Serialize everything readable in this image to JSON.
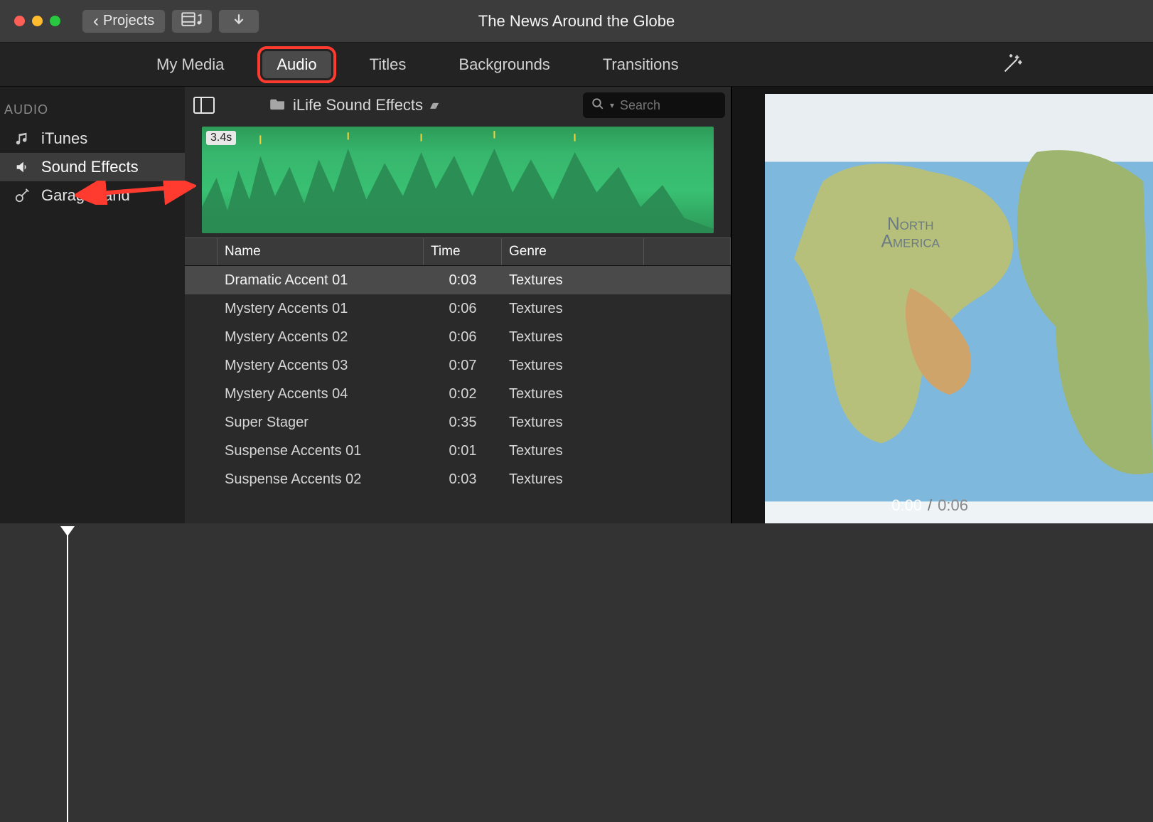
{
  "window": {
    "title": "The News Around the Globe"
  },
  "toolbar": {
    "projects_label": "Projects"
  },
  "tabs": {
    "items": [
      {
        "label": "My Media"
      },
      {
        "label": "Audio"
      },
      {
        "label": "Titles"
      },
      {
        "label": "Backgrounds"
      },
      {
        "label": "Transitions"
      }
    ],
    "active_index": 1
  },
  "sidebar": {
    "heading": "AUDIO",
    "items": [
      {
        "label": "iTunes",
        "icon": "music-note"
      },
      {
        "label": "Sound Effects",
        "icon": "speaker"
      },
      {
        "label": "GarageBand",
        "icon": "guitar"
      }
    ],
    "selected_index": 1
  },
  "browser": {
    "album_label": "iLife Sound Effects",
    "search_placeholder": "Search",
    "waveform_badge": "3.4s",
    "columns": {
      "name": "Name",
      "time": "Time",
      "genre": "Genre"
    },
    "rows": [
      {
        "name": "Dramatic Accent 01",
        "time": "0:03",
        "genre": "Textures"
      },
      {
        "name": "Mystery Accents 01",
        "time": "0:06",
        "genre": "Textures"
      },
      {
        "name": "Mystery Accents 02",
        "time": "0:06",
        "genre": "Textures"
      },
      {
        "name": "Mystery Accents 03",
        "time": "0:07",
        "genre": "Textures"
      },
      {
        "name": "Mystery Accents 04",
        "time": "0:02",
        "genre": "Textures"
      },
      {
        "name": "Super Stager",
        "time": "0:35",
        "genre": "Textures"
      },
      {
        "name": "Suspense Accents 01",
        "time": "0:01",
        "genre": "Textures"
      },
      {
        "name": "Suspense Accents 02",
        "time": "0:03",
        "genre": "Textures"
      }
    ],
    "selected_row": 0
  },
  "playback": {
    "current": "0:00",
    "total": "0:06"
  },
  "annotations": {
    "audio_tab_highlighted": true,
    "sidebar_arrow_visible": true
  },
  "colors": {
    "waveform_green": "#3cc279",
    "highlight_red": "#ff3b30"
  }
}
